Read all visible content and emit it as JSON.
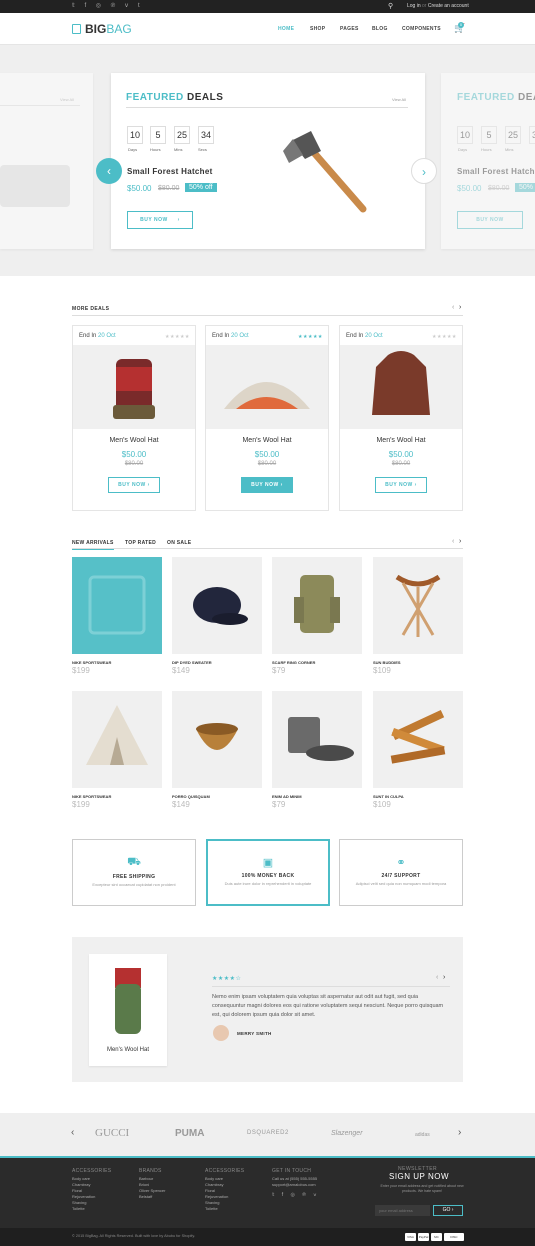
{
  "topbar": {
    "social_icons": [
      "twitter-icon",
      "facebook-icon",
      "instagram-icon",
      "pinterest-icon",
      "vine-icon",
      "tumblr-icon"
    ],
    "login": "Log in",
    "or": "or",
    "create": "Create an account"
  },
  "header": {
    "logo_a": "BIG",
    "logo_b": "BAG",
    "nav": [
      "HOME",
      "SHOP",
      "PAGES",
      "BLOG",
      "COMPONENTS"
    ],
    "cart_count": "0"
  },
  "featured": {
    "title_a": "FEATURED",
    "title_b": "DEALS",
    "view_all": "View All",
    "countdown": [
      {
        "value": "10",
        "label": "Days"
      },
      {
        "value": "5",
        "label": "Hours"
      },
      {
        "value": "25",
        "label": "Mins"
      },
      {
        "value": "34",
        "label": "Secs"
      }
    ],
    "product": "Small Forest Hatchet",
    "price": "$50.00",
    "old_price": "$80.00",
    "discount": "50% off",
    "buy": "BUY NOW",
    "right_title_a": "FEATURED",
    "right_title_b": "DEA",
    "right_product": "Small Forest Hatch",
    "right_discount": "50%",
    "right_buy": "BUY NOW",
    "left_view_all": "View All"
  },
  "more_deals": {
    "title": "MORE DEALS",
    "items": [
      {
        "end": "End In",
        "date": "20 Oct",
        "name": "Men's Wool Hat",
        "price": "$50.00",
        "old": "$80.00",
        "buy": "BUY NOW",
        "stars": "★★★★★",
        "rating": 0
      },
      {
        "end": "End In",
        "date": "20 Oct",
        "name": "Men's Wool Hat",
        "price": "$50.00",
        "old": "$80.00",
        "buy": "BUY NOW",
        "stars": "★★★★★",
        "rating": 4
      },
      {
        "end": "End In",
        "date": "20 Oct",
        "name": "Men's Wool Hat",
        "price": "$50.00",
        "old": "$80.00",
        "buy": "BUY NOW",
        "stars": "★★★★★",
        "rating": 0
      }
    ]
  },
  "products": {
    "tabs": [
      "NEW ARRIVALS",
      "TOP RATED",
      "ON SALE"
    ],
    "items": [
      {
        "name": "NIKE SPORTSWEAR",
        "price": "$199"
      },
      {
        "name": "DIP DYED SWEATER",
        "price": "$149"
      },
      {
        "name": "SCARF RING CORNER",
        "price": "$79"
      },
      {
        "name": "SUN BUDDIES",
        "price": "$109"
      },
      {
        "name": "NIKE SPORTSWEAR",
        "price": "$199"
      },
      {
        "name": "PORRO QUISQUAM",
        "price": "$149"
      },
      {
        "name": "ENIM AD MINIM",
        "price": "$79"
      },
      {
        "name": "SUNT IN CULPA",
        "price": "$109"
      }
    ]
  },
  "features": [
    {
      "title": "FREE SHIPPING",
      "text": "Excepteur sint occaecat cupidatat non proident"
    },
    {
      "title": "100% MONEY BACK",
      "text": "Duis aute irure dolor in reprehenderit in voluptate"
    },
    {
      "title": "24/7 SUPPORT",
      "text": "Adipisci velit sed quia non numquam modi tempora"
    }
  ],
  "testimonial": {
    "product": "Men's Wool Hat",
    "stars": "★★★★☆",
    "text": "Nemo enim ipsam voluptatem quia voluptas sit aspernatur aut odit aut fugit, sed quia consequuntur magni dolores eos qui ratione voluptatem sequi nesciunt. Neque porro quisquam est, qui dolorem ipsum quia dolor sit amet.",
    "author": "MERRY SMITH"
  },
  "brands": [
    "GUCCI",
    "PUMA",
    "DSQUARED2",
    "Slazenger",
    "adidas"
  ],
  "footer": {
    "cols": [
      {
        "title": "ACCESSORIES",
        "links": [
          "Body care",
          "Chambray",
          "Floral",
          "Rejuvenation",
          "Shaving",
          "Toilette"
        ]
      },
      {
        "title": "BRANDS",
        "links": [
          "Barbour",
          "Brioni",
          "Oliver Spencer",
          "Belstaff"
        ]
      },
      {
        "title": "ACCESSORIES",
        "links": [
          "Body care",
          "Chambray",
          "Floral",
          "Rejuvenation",
          "Shaving",
          "Toilette"
        ]
      }
    ],
    "contact_title": "GET IN TOUCH",
    "contact": [
      "Call us at (555) 555-5555",
      "support@arnalobus.com"
    ],
    "newsletter_small": "NEWSLETTER",
    "newsletter_title": "SIGN UP NOW",
    "newsletter_text": "Enter your email address and get notified about new products. We hate spam!",
    "email_placeholder": "your email address",
    "go": "GO",
    "copyright": "© 2015 BigBag. All Rights Reserved. Built with love by Abubu for Shopify.",
    "payments": [
      "VISA",
      "PayPal",
      "MC",
      "DISC"
    ]
  },
  "colors": {
    "accent": "#4cbdc7",
    "dark": "#2b2b2b"
  }
}
